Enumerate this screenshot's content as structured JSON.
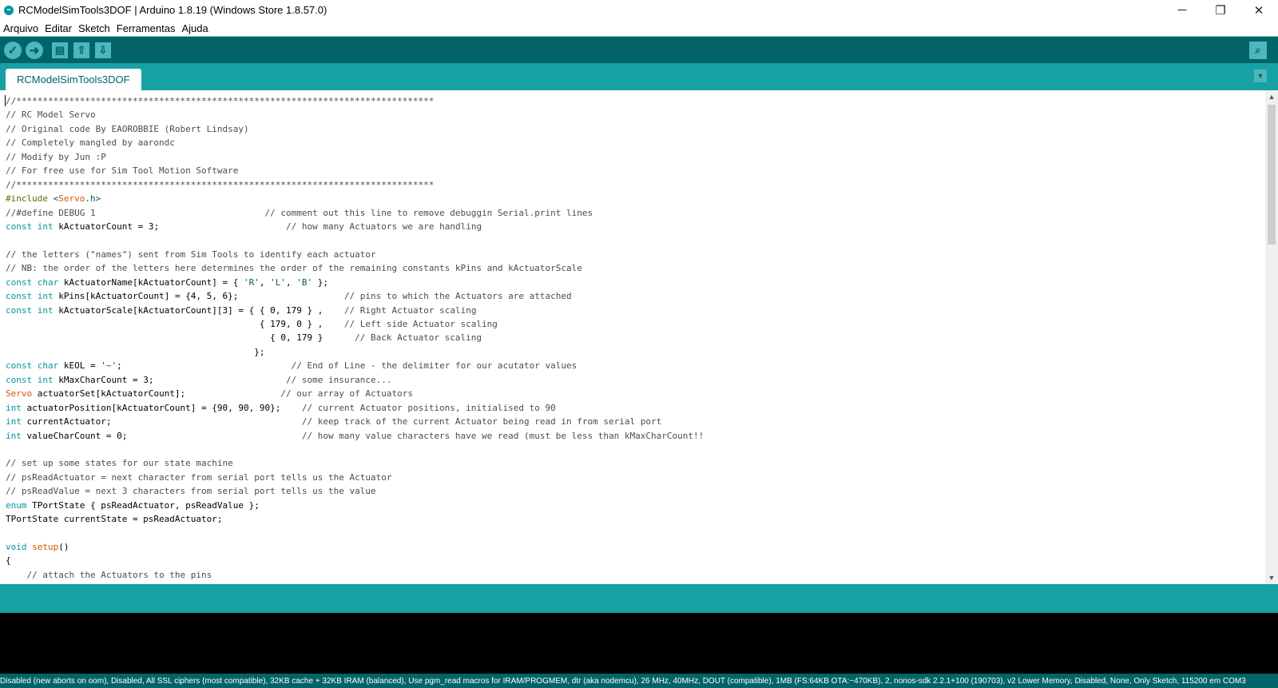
{
  "window": {
    "title": "RCModelSimTools3DOF | Arduino 1.8.19 (Windows Store 1.8.57.0)",
    "minimize_glyph": "─",
    "restore_glyph": "❐",
    "close_glyph": "✕"
  },
  "menu": [
    "Arquivo",
    "Editar",
    "Sketch",
    "Ferramentas",
    "Ajuda"
  ],
  "toolbar": {
    "buttons": [
      {
        "name": "verify-button",
        "icon": "check-icon",
        "glyph": "✓"
      },
      {
        "name": "upload-button",
        "icon": "arrow-right-icon",
        "glyph": "➜"
      },
      {
        "name": "new-button",
        "icon": "new-file-icon",
        "glyph": "▤"
      },
      {
        "name": "open-button",
        "icon": "arrow-up-icon",
        "glyph": "⇧"
      },
      {
        "name": "save-button",
        "icon": "arrow-down-icon",
        "glyph": "⇩"
      }
    ],
    "serial_monitor_glyph": "⌕"
  },
  "tabs": [
    {
      "label": "RCModelSimTools3DOF",
      "active": true
    }
  ],
  "tab_menu_glyph": "▼",
  "editor": {
    "lines": [
      [
        [
          "cm",
          "//*******************************************************************************"
        ]
      ],
      [
        [
          "cm",
          "// RC Model Servo"
        ]
      ],
      [
        [
          "cm",
          "// Original code By EAOROBBIE (Robert Lindsay)"
        ]
      ],
      [
        [
          "cm",
          "// Completely mangled by aarondc"
        ]
      ],
      [
        [
          "cm",
          "// Modify by Jun :P"
        ]
      ],
      [
        [
          "cm",
          "// For free use for Sim Tool Motion Software"
        ]
      ],
      [
        [
          "cm",
          "//*******************************************************************************"
        ]
      ],
      [
        [
          "pp",
          "#include "
        ],
        [
          "st",
          "<"
        ],
        [
          "cl",
          "Servo"
        ],
        [
          "st",
          ".h>"
        ]
      ],
      [
        [
          "cm",
          "//#define DEBUG 1                                // comment out this line to remove debuggin Serial.print lines"
        ]
      ],
      [
        [
          "kw",
          "const"
        ],
        [
          "",
          " "
        ],
        [
          "ty",
          "int"
        ],
        [
          "",
          " kActuatorCount = 3;                        "
        ],
        [
          "cm",
          "// how many Actuators we are handling"
        ]
      ],
      [
        [
          "",
          ""
        ]
      ],
      [
        [
          "cm",
          "// the letters (\"names\") sent from Sim Tools to identify each actuator"
        ]
      ],
      [
        [
          "cm",
          "// NB: the order of the letters here determines the order of the remaining constants kPins and kActuatorScale"
        ]
      ],
      [
        [
          "kw",
          "const"
        ],
        [
          "",
          " "
        ],
        [
          "ty",
          "char"
        ],
        [
          "",
          " kActuatorName[kActuatorCount] = { "
        ],
        [
          "st",
          "'R'"
        ],
        [
          "",
          ", "
        ],
        [
          "st",
          "'L'"
        ],
        [
          "",
          ", "
        ],
        [
          "st",
          "'B'"
        ],
        [
          "",
          " };"
        ]
      ],
      [
        [
          "kw",
          "const"
        ],
        [
          "",
          " "
        ],
        [
          "ty",
          "int"
        ],
        [
          "",
          " kPins[kActuatorCount] = {4, 5, 6};                    "
        ],
        [
          "cm",
          "// pins to which the Actuators are attached"
        ]
      ],
      [
        [
          "kw",
          "const"
        ],
        [
          "",
          " "
        ],
        [
          "ty",
          "int"
        ],
        [
          "",
          " kActuatorScale[kActuatorCount][3] = { { 0, 179 } ,    "
        ],
        [
          "cm",
          "// Right Actuator scaling"
        ]
      ],
      [
        [
          "",
          "                                                { 179, 0 } ,    "
        ],
        [
          "cm",
          "// Left side Actuator scaling"
        ]
      ],
      [
        [
          "",
          "                                                  { 0, 179 }      "
        ],
        [
          "cm",
          "// Back Actuator scaling"
        ]
      ],
      [
        [
          "",
          "                                               };"
        ]
      ],
      [
        [
          "kw",
          "const"
        ],
        [
          "",
          " "
        ],
        [
          "ty",
          "char"
        ],
        [
          "",
          " kEOL = "
        ],
        [
          "st",
          "'~'"
        ],
        [
          "",
          ";                                "
        ],
        [
          "cm",
          "// End of Line - the delimiter for our acutator values"
        ]
      ],
      [
        [
          "kw",
          "const"
        ],
        [
          "",
          " "
        ],
        [
          "ty",
          "int"
        ],
        [
          "",
          " kMaxCharCount = 3;                         "
        ],
        [
          "cm",
          "// some insurance..."
        ]
      ],
      [
        [
          "cl",
          "Servo"
        ],
        [
          "",
          " actuatorSet[kActuatorCount];                  "
        ],
        [
          "cm",
          "// our array of Actuators"
        ]
      ],
      [
        [
          "ty",
          "int"
        ],
        [
          "",
          " actuatorPosition[kActuatorCount] = {90, 90, 90};    "
        ],
        [
          "cm",
          "// current Actuator positions, initialised to 90"
        ]
      ],
      [
        [
          "ty",
          "int"
        ],
        [
          "",
          " currentActuator;                                    "
        ],
        [
          "cm",
          "// keep track of the current Actuator being read in from serial port"
        ]
      ],
      [
        [
          "ty",
          "int"
        ],
        [
          "",
          " valueCharCount = 0;                                 "
        ],
        [
          "cm",
          "// how many value characters have we read (must be less than kMaxCharCount!!"
        ]
      ],
      [
        [
          "",
          ""
        ]
      ],
      [
        [
          "cm",
          "// set up some states for our state machine"
        ]
      ],
      [
        [
          "cm",
          "// psReadActuator = next character from serial port tells us the Actuator"
        ]
      ],
      [
        [
          "cm",
          "// psReadValue = next 3 characters from serial port tells us the value"
        ]
      ],
      [
        [
          "kw",
          "enum"
        ],
        [
          "",
          " TPortState { psReadActuator, psReadValue };"
        ]
      ],
      [
        [
          "",
          "TPortState currentState = psReadActuator;"
        ]
      ],
      [
        [
          "",
          ""
        ]
      ],
      [
        [
          "ty",
          "void"
        ],
        [
          "",
          " "
        ],
        [
          "fn",
          "setup"
        ],
        [
          "",
          "()"
        ]
      ],
      [
        [
          "",
          "{"
        ]
      ],
      [
        [
          "",
          "    "
        ],
        [
          "cm",
          "// attach the Actuators to the pins"
        ]
      ]
    ]
  },
  "scrollbar": {
    "up_glyph": "▲",
    "down_glyph": "▼"
  },
  "status_bar": "Disabled (new aborts on oom), Disabled, All SSL ciphers (most compatible), 32KB cache + 32KB IRAM (balanced), Use pgm_read macros for IRAM/PROGMEM, dtr (aka nodemcu), 26 MHz, 40MHz, DOUT (compatible), 1MB (FS:64KB OTA:~470KB), 2, nonos-sdk 2.2.1+100 (190703), v2 Lower Memory, Disabled, None, Only Sketch, 115200 em COM3",
  "colors": {
    "toolbar": "#006468",
    "tabbar": "#17a1a5",
    "button": "#4db7bb",
    "keyword": "#00979c",
    "class": "#d35400",
    "comment": "#434f54",
    "console": "#000000"
  }
}
